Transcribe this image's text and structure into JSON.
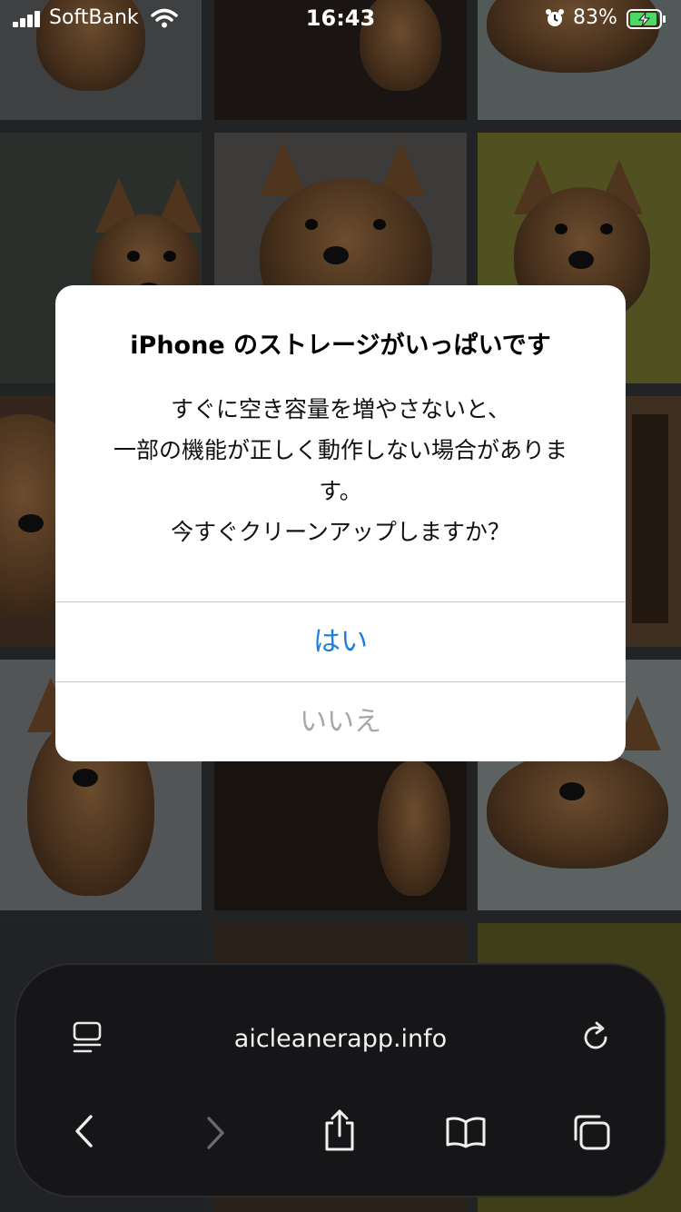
{
  "status_bar": {
    "carrier": "SoftBank",
    "time": "16:43",
    "battery_percent": "83%"
  },
  "alert": {
    "title": "iPhone のストレージがいっぱいです",
    "message": "すぐに空き容量を増やさないと、\n一部の機能が正しく動作しない場合がありま\nす。\n今すぐクリーンアップしますか？",
    "yes_label": "はい",
    "no_label": "いいえ"
  },
  "safari": {
    "url": "aicleanerapp.info"
  },
  "colors": {
    "alert_button_primary": "#1a7fe0",
    "alert_button_secondary": "#a7a7aa"
  }
}
